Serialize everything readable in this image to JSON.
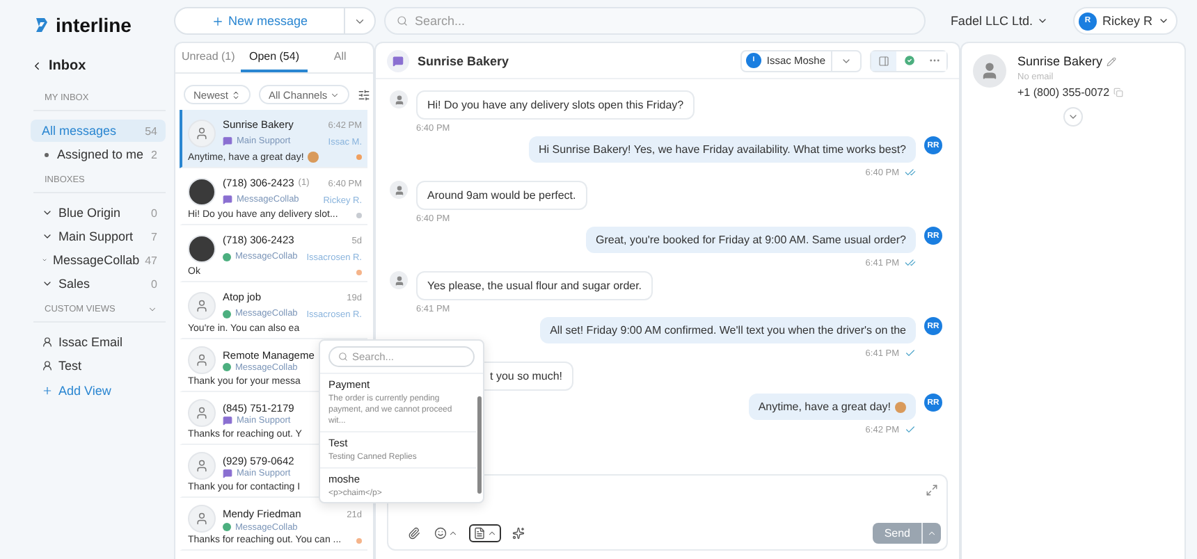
{
  "brand": "interline",
  "sidebar": {
    "back": "Inbox",
    "sections": [
      {
        "title": "MY INBOX",
        "items": [
          {
            "label": "All messages",
            "count": "54",
            "selected": true,
            "kind": "plain"
          },
          {
            "label": "Assigned to me",
            "count": "2",
            "selected": false,
            "kind": "bullet"
          }
        ]
      },
      {
        "title": "INBOXES",
        "items": [
          {
            "label": "Blue Origin",
            "count": "0",
            "selected": false,
            "kind": "folder"
          },
          {
            "label": "Main Support",
            "count": "7",
            "selected": false,
            "kind": "folder"
          },
          {
            "label": "MessageCollab",
            "count": "47",
            "selected": false,
            "kind": "folder"
          },
          {
            "label": "Sales",
            "count": "0",
            "selected": false,
            "kind": "folder"
          }
        ]
      },
      {
        "title": "CUSTOM VIEWS",
        "collapsible": true,
        "items": [
          {
            "label": "Issac Email",
            "selected": false,
            "kind": "view"
          },
          {
            "label": "Test",
            "selected": false,
            "kind": "view"
          }
        ]
      }
    ],
    "add_view": "Add View"
  },
  "topbar": {
    "new_message": "New message",
    "search": {
      "placeholder": "Search..."
    },
    "org": "Fadel LLC Ltd.",
    "user": {
      "name": "Rickey R",
      "initial": "R"
    }
  },
  "conversations": {
    "tabs": [
      {
        "label": "Unread (1)",
        "selected": false
      },
      {
        "label": "Open (54)",
        "selected": true
      },
      {
        "label": "All",
        "selected": false
      }
    ],
    "sort": "Newest",
    "channel_filter": "All Channels",
    "items": [
      {
        "name": "Sunrise Bakery",
        "kind": "person",
        "channel": {
          "name": "Main Support",
          "kind": "chat"
        },
        "agent": "Issac M.",
        "time": "6:42 PM",
        "preview": "Anytime, have a great day!",
        "emoji": true,
        "color": "#f0a060",
        "selected": true
      },
      {
        "name": "(718) 306-2423",
        "count": "(1)",
        "kind": "photo",
        "channel": {
          "name": "MessageCollab",
          "kind": "chat"
        },
        "agent": "Rickey R.",
        "time": "6:40 PM",
        "preview": "Hi! Do you have any delivery slot...",
        "color": "#c8ccd2",
        "selected": false
      },
      {
        "name": "(718) 306-2423",
        "kind": "photo",
        "channel": {
          "name": "MessageCollab",
          "kind": "dot"
        },
        "agent": "Issacrosen R.",
        "time": "5d",
        "preview": "Ok",
        "color": "#f5b48a",
        "selected": false
      },
      {
        "name": "Atop job",
        "kind": "person",
        "channel": {
          "name": "MessageCollab",
          "kind": "dot"
        },
        "agent": "Issacrosen R.",
        "time": "19d",
        "preview": "You're in. You can also ea",
        "selected": false
      },
      {
        "name": "Remote Manageme",
        "kind": "person",
        "channel": {
          "name": "MessageCollab",
          "kind": "dot"
        },
        "preview": "Thank you for your messa",
        "selected": false
      },
      {
        "name": "(845) 751-2179",
        "kind": "person",
        "channel": {
          "name": "Main Support",
          "kind": "chat"
        },
        "preview": "Thanks for reaching out. Y",
        "selected": false
      },
      {
        "name": "(929) 579-0642",
        "kind": "person",
        "channel": {
          "name": "Main Support",
          "kind": "chat"
        },
        "preview": "Thank you for contacting I",
        "selected": false
      },
      {
        "name": "Mendy Friedman",
        "kind": "person",
        "channel": {
          "name": "MessageCollab",
          "kind": "dot"
        },
        "time": "21d",
        "preview": "Thanks for reaching out. You can ...",
        "color": "#f5b48a",
        "selected": false
      }
    ]
  },
  "chat": {
    "title": "Sunrise Bakery",
    "assignee": {
      "initial": "I",
      "name": "Issac Moshe"
    },
    "messages": [
      {
        "kind": "in",
        "text": "Hi! Do you have any delivery slots open this Friday?",
        "time": "6:40 PM"
      },
      {
        "kind": "out",
        "text": "Hi Sunrise Bakery! Yes, we have Friday availability. What time works best?",
        "time": "6:40 PM",
        "read": true,
        "avatar": "RR"
      },
      {
        "kind": "in",
        "text": "Around 9am would be perfect.",
        "time": "6:40 PM"
      },
      {
        "kind": "out",
        "text": "Great, you're booked for Friday at 9:00 AM. Same usual order?",
        "time": "6:41 PM",
        "read": true,
        "avatar": "RR"
      },
      {
        "kind": "in",
        "text": "Yes please, the usual flour and sugar order.",
        "time": "6:41 PM"
      },
      {
        "kind": "out",
        "text": "All set! Friday 9:00 AM confirmed. We'll text you when the driver's on the",
        "time": "6:41 PM",
        "read": false,
        "avatar": "RR"
      },
      {
        "kind": "covered",
        "text": "t you so much!"
      },
      {
        "kind": "out",
        "text": "Anytime, have a great day!",
        "emoji": true,
        "time": "6:42 PM",
        "read": false,
        "avatar": "RR"
      }
    ],
    "send": "Send",
    "canned_open": true,
    "canned": {
      "placeholder": "Search...",
      "items": [
        {
          "title": "Payment",
          "body": "The order is currently pending payment, and we cannot proceed wit..."
        },
        {
          "title": "Test",
          "body": "Testing Canned Replies"
        },
        {
          "title": "moshe",
          "body": "<p>chaim</p>"
        }
      ]
    }
  },
  "contact": {
    "name": "Sunrise Bakery",
    "email": "No email",
    "phone": "+1 (800) 355-0072"
  }
}
